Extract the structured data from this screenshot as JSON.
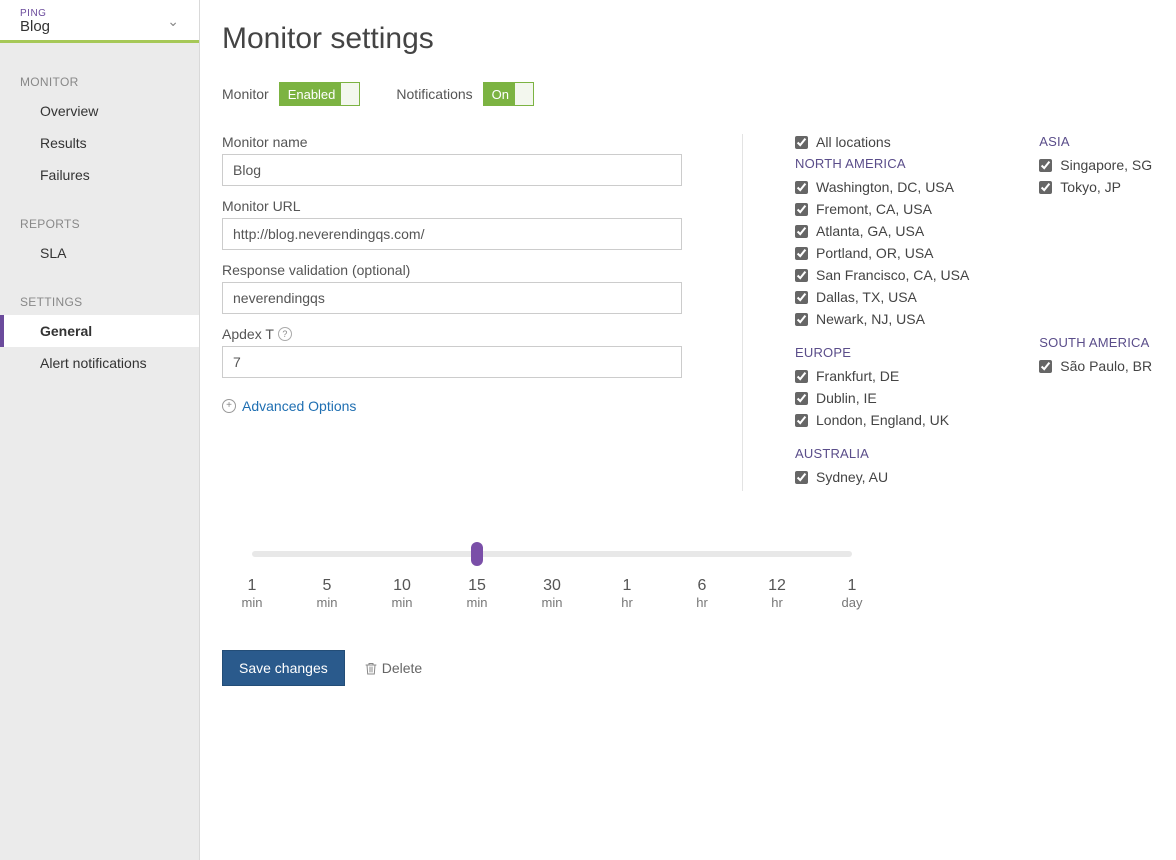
{
  "sidebar": {
    "header": {
      "type": "PING",
      "name": "Blog"
    },
    "sections": [
      {
        "title": "MONITOR",
        "items": [
          {
            "label": "Overview",
            "id": "overview"
          },
          {
            "label": "Results",
            "id": "results"
          },
          {
            "label": "Failures",
            "id": "failures"
          }
        ]
      },
      {
        "title": "REPORTS",
        "items": [
          {
            "label": "SLA",
            "id": "sla"
          }
        ]
      },
      {
        "title": "SETTINGS",
        "items": [
          {
            "label": "General",
            "id": "general",
            "active": true
          },
          {
            "label": "Alert notifications",
            "id": "alert-notifications"
          }
        ]
      }
    ]
  },
  "page": {
    "title": "Monitor settings",
    "monitor_label": "Monitor",
    "monitor_toggle": "Enabled",
    "notifications_label": "Notifications",
    "notifications_toggle": "On"
  },
  "form": {
    "monitor_name": {
      "label": "Monitor name",
      "value": "Blog"
    },
    "monitor_url": {
      "label": "Monitor URL",
      "value": "http://blog.neverendingqs.com/"
    },
    "response_validation": {
      "label": "Response validation (optional)",
      "value": "neverendingqs"
    },
    "apdex_t": {
      "label": "Apdex T",
      "value": "7"
    },
    "advanced_label": "Advanced Options"
  },
  "locations": {
    "all_label": "All locations",
    "regions": [
      {
        "name": "NORTH AMERICA",
        "column": "left",
        "items": [
          "Washington, DC, USA",
          "Fremont, CA, USA",
          "Atlanta, GA, USA",
          "Portland, OR, USA",
          "San Francisco, CA, USA",
          "Dallas, TX, USA",
          "Newark, NJ, USA"
        ]
      },
      {
        "name": "EUROPE",
        "column": "left",
        "items": [
          "Frankfurt, DE",
          "Dublin, IE",
          "London, England, UK"
        ]
      },
      {
        "name": "AUSTRALIA",
        "column": "left",
        "items": [
          "Sydney, AU"
        ]
      },
      {
        "name": "ASIA",
        "column": "right",
        "items": [
          "Singapore, SG",
          "Tokyo, JP"
        ]
      },
      {
        "name": "SOUTH AMERICA",
        "column": "right",
        "items": [
          "São Paulo, BR"
        ]
      }
    ]
  },
  "slider": {
    "selected_index": 3,
    "ticks": [
      {
        "num": "1",
        "unit": "min"
      },
      {
        "num": "5",
        "unit": "min"
      },
      {
        "num": "10",
        "unit": "min"
      },
      {
        "num": "15",
        "unit": "min"
      },
      {
        "num": "30",
        "unit": "min"
      },
      {
        "num": "1",
        "unit": "hr"
      },
      {
        "num": "6",
        "unit": "hr"
      },
      {
        "num": "12",
        "unit": "hr"
      },
      {
        "num": "1",
        "unit": "day"
      }
    ]
  },
  "actions": {
    "save": "Save changes",
    "delete": "Delete"
  }
}
